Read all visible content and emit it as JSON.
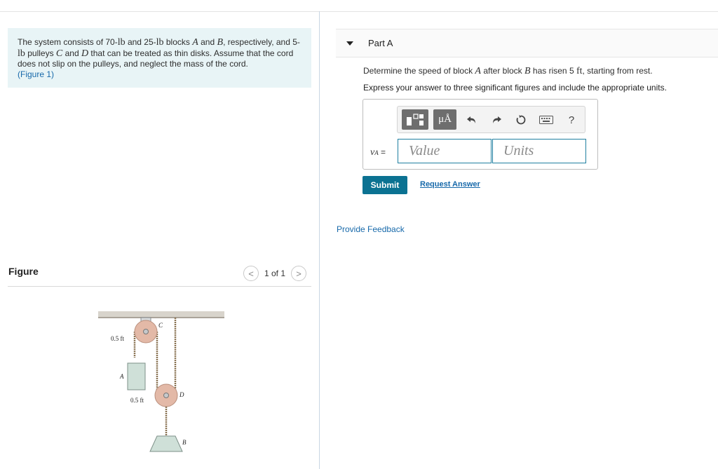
{
  "problem": {
    "text_1": "The system consists of 70-",
    "unit_lb_1": "lb",
    "text_2": " and 25-",
    "unit_lb_2": "lb",
    "text_3": " blocks ",
    "var_A": "A",
    "text_4": " and ",
    "var_B": "B",
    "text_5": ", respectively, and 5-",
    "unit_lb_3": "lb",
    "text_6": " pulleys ",
    "var_C": "C",
    "text_7": " and ",
    "var_D": "D",
    "text_8": " that can be treated as thin disks. Assume that the cord does not slip on the pulleys, and neglect the mass of the cord.",
    "figure_link": "(Figure 1)"
  },
  "figure": {
    "title": "Figure",
    "pager": "1 of 1",
    "prev_glyph": "<",
    "next_glyph": ">",
    "labels": {
      "radius_C": "0.5 ft",
      "radius_D": "0.5 ft",
      "pulley_C": "C",
      "pulley_D": "D",
      "block_A": "A",
      "block_B": "B"
    }
  },
  "part_a": {
    "label": "Part A",
    "question_1": "Determine the speed of block ",
    "question_var_A": "A",
    "question_2": " after block ",
    "question_var_B": "B",
    "question_3": " has risen 5 ",
    "question_unit": "ft",
    "question_4": ", starting from rest.",
    "instruction": "Express your answer to three significant figures and include the appropriate units.",
    "answer_var": "v",
    "answer_sub": "A",
    "answer_eq": " =",
    "value_placeholder": "Value",
    "units_placeholder": "Units",
    "toolbar": {
      "units_button": "μÅ",
      "help_label": "?"
    },
    "submit_label": "Submit",
    "request_answer_label": "Request Answer"
  },
  "feedback_label": "Provide Feedback"
}
